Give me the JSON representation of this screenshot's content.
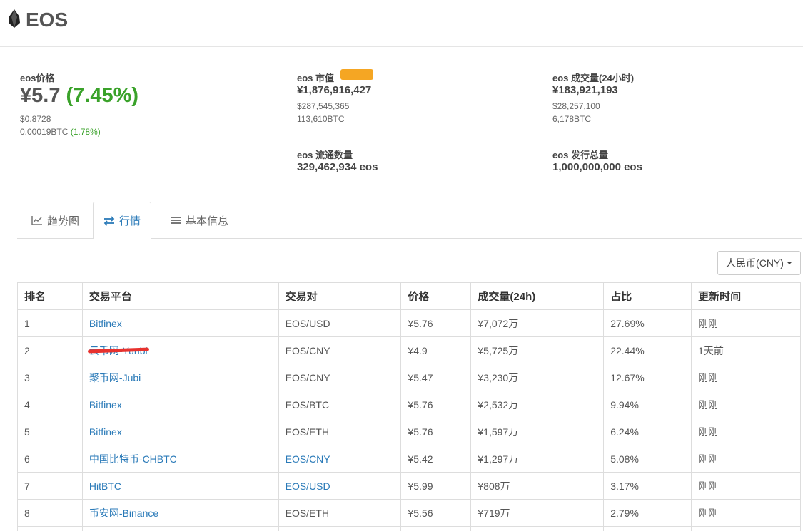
{
  "header": {
    "title": "EOS"
  },
  "stats": {
    "price": {
      "label": "eos价格",
      "value": "¥5.7",
      "change": "(7.45%)",
      "usd": "$0.8728",
      "btc": "0.00019BTC",
      "btc_change": "(1.78%)"
    },
    "market_cap": {
      "label": "eos 市值",
      "value": "¥1,876,916,427",
      "usd": "$287,545,365",
      "btc": "113,610BTC",
      "badge_color": "#f5a623"
    },
    "volume": {
      "label": "eos 成交量(24小时)",
      "value": "¥183,921,193",
      "usd": "$28,257,100",
      "btc": "6,178BTC"
    },
    "circulating": {
      "label": "eos 流通数量",
      "value": "329,462,934 eos"
    },
    "total_supply": {
      "label": "eos 发行总量",
      "value": "1,000,000,000 eos"
    }
  },
  "tabs": [
    {
      "label": "趋势图",
      "icon": "line-chart-icon",
      "active": false
    },
    {
      "label": "行情",
      "icon": "exchange-icon",
      "active": true
    },
    {
      "label": "基本信息",
      "icon": "list-icon",
      "active": false
    }
  ],
  "currency_select": {
    "value": "人民币(CNY)"
  },
  "table": {
    "headers": [
      "排名",
      "交易平台",
      "交易对",
      "价格",
      "成交量(24h)",
      "占比",
      "更新时间"
    ],
    "rows": [
      {
        "rank": "1",
        "exchange": "Bitfinex",
        "pair": "EOS/USD",
        "pair_link": false,
        "price": "¥5.76",
        "volume": "¥7,072万",
        "share": "27.69%",
        "updated": "刚刚"
      },
      {
        "rank": "2",
        "exchange": "云币网-Yunbi",
        "pair": "EOS/CNY",
        "pair_link": false,
        "price": "¥4.9",
        "volume": "¥5,725万",
        "share": "22.44%",
        "updated": "1天前",
        "redacted": true
      },
      {
        "rank": "3",
        "exchange": "聚币网-Jubi",
        "pair": "EOS/CNY",
        "pair_link": false,
        "price": "¥5.47",
        "volume": "¥3,230万",
        "share": "12.67%",
        "updated": "刚刚"
      },
      {
        "rank": "4",
        "exchange": "Bitfinex",
        "pair": "EOS/BTC",
        "pair_link": false,
        "price": "¥5.76",
        "volume": "¥2,532万",
        "share": "9.94%",
        "updated": "刚刚"
      },
      {
        "rank": "5",
        "exchange": "Bitfinex",
        "pair": "EOS/ETH",
        "pair_link": false,
        "price": "¥5.76",
        "volume": "¥1,597万",
        "share": "6.24%",
        "updated": "刚刚"
      },
      {
        "rank": "6",
        "exchange": "中国比特币-CHBTC",
        "pair": "EOS/CNY",
        "pair_link": true,
        "price": "¥5.42",
        "volume": "¥1,297万",
        "share": "5.08%",
        "updated": "刚刚"
      },
      {
        "rank": "7",
        "exchange": "HitBTC",
        "pair": "EOS/USD",
        "pair_link": true,
        "price": "¥5.99",
        "volume": "¥808万",
        "share": "3.17%",
        "updated": "刚刚"
      },
      {
        "rank": "8",
        "exchange": "币安网-Binance",
        "pair": "EOS/ETH",
        "pair_link": false,
        "price": "¥5.56",
        "volume": "¥719万",
        "share": "2.79%",
        "updated": "刚刚"
      }
    ]
  }
}
